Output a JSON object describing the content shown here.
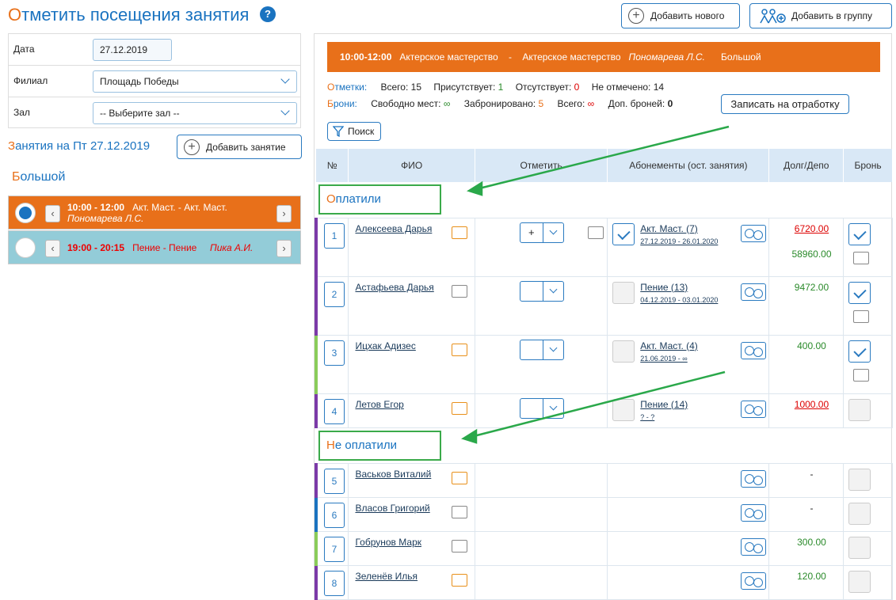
{
  "page": {
    "title_first": "О",
    "title_rest": "тметить посещения занятия",
    "help": "?"
  },
  "top_buttons": {
    "add_new": "Добавить нового",
    "add_group": "Добавить в группу"
  },
  "form": {
    "date_label": "Дата",
    "date_value": "27.12.2019",
    "branch_label": "Филиал",
    "branch_value": "Площадь Победы",
    "hall_label": "Зал",
    "hall_value": "-- Выберите зал --"
  },
  "lessons": {
    "title_first": "З",
    "title_rest": "анятия на Пт 27.12.2019",
    "add_lesson": "Добавить занятие",
    "hall_first": "Б",
    "hall_rest": "ольшой",
    "items": [
      {
        "time": "10:00 - 12:00",
        "name": "Акт. Маст. - Акт. Маст.",
        "teacher": "Пономарева Л.С."
      },
      {
        "time": "19:00 - 20:15",
        "name": "Пение - Пение",
        "teacher": "Пика А.И."
      }
    ]
  },
  "header_bar": {
    "time": "10:00-12:00",
    "course": "Актерское мастерство",
    "dash": "-",
    "group": "Актерское мастерство",
    "teacher": "Пономарева Л.С.",
    "hall": "Большой"
  },
  "stats": {
    "marks_first": "О",
    "marks_rest": "тметки:",
    "total_label": "Всего:",
    "total": "15",
    "present_label": "Присутствует:",
    "present": "1",
    "absent_label": "Отсутствует:",
    "absent": "0",
    "unmarked_label": "Не отмечено:",
    "unmarked": "14",
    "book_first": "Б",
    "book_rest": "рони:",
    "free_label": "Свободно мест:",
    "free": "∞",
    "booked_label": "Забронировано:",
    "booked": "5",
    "all_label": "Всего:",
    "all": "∞",
    "extra_label": "Доп. броней:",
    "extra": "0",
    "makeup_button": "Записать на отработку"
  },
  "search_button": "Поиск",
  "table": {
    "headers": [
      "№",
      "ФИО",
      "Отметить",
      "Абонементы (ост. занятия)",
      "Долг/Депо",
      "Бронь"
    ],
    "paid_first": "О",
    "paid_rest": "платили",
    "unpaid_first": "Н",
    "unpaid_rest": "е оплатили",
    "paid_rows": [
      {
        "num": "1",
        "name": "Алексеева Дарья",
        "mark": "+",
        "sub": "Акт. Маст. (7)",
        "dates": "27.12.2019 - 26.01.2020",
        "debt": "6720.00",
        "depo": "58960.00"
      },
      {
        "num": "2",
        "name": "Астафьева Дарья",
        "mark": "",
        "sub": "Пение (13)",
        "dates": "04.12.2019 - 03.01.2020",
        "debt": "",
        "depo": "9472.00"
      },
      {
        "num": "3",
        "name": "Ицхак Адизес",
        "mark": "",
        "sub": "Акт. Маст. (4)",
        "dates": "21.06.2019 - ∞",
        "debt": "",
        "depo": "400.00"
      },
      {
        "num": "4",
        "name": "Летов Егор",
        "mark": "",
        "sub": "Пение (14)",
        "dates": "? - ?",
        "debt": "1000.00",
        "depo": ""
      }
    ],
    "unpaid_rows": [
      {
        "num": "5",
        "name": "Васьков Виталий",
        "debt": "-"
      },
      {
        "num": "6",
        "name": "Власов Григорий",
        "debt": "-"
      },
      {
        "num": "7",
        "name": "Гобрунов Марк",
        "debt": "300.00"
      },
      {
        "num": "8",
        "name": "Зеленёв Илья",
        "debt": "120.00"
      }
    ]
  }
}
